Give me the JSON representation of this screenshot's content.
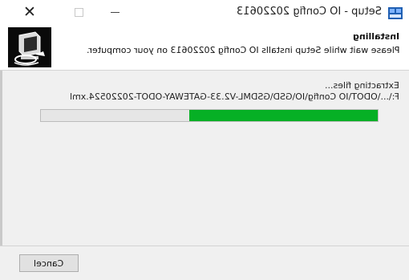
{
  "window": {
    "title": "Setup - IO Config 20220613",
    "controls": {
      "close_glyph": "✕",
      "close_icon": "close-icon",
      "maximize_icon": "maximize-icon",
      "minimize_icon": "minimize-icon"
    },
    "app_icon": "setup-app-icon"
  },
  "header": {
    "title": "Installing",
    "subtitle": "Please wait while Setup installs IO Config 20220613 on your computer.",
    "logo_icon": "installer-computer-icon"
  },
  "body": {
    "status": "Extracting files...",
    "current_file": "F:\\...\\ODOT\\IO Config\\IO\\GSD\\GSDML-V2.33-GATEWAY-ODOT-20220524.xml",
    "progress_fraction": 0.56,
    "progress_color": "#06b025"
  },
  "footer": {
    "cancel_label": "Cancel"
  }
}
